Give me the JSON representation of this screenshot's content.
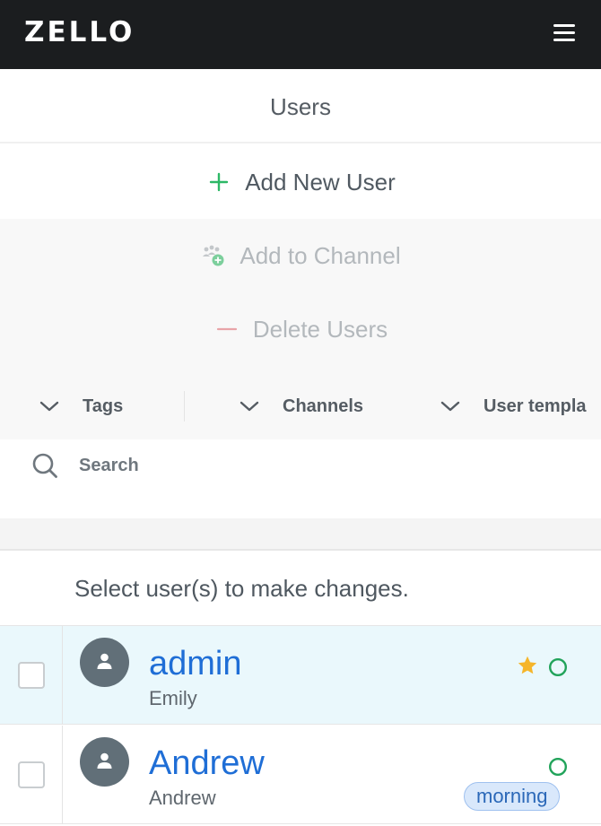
{
  "app": {
    "logo_text": "ZELLO",
    "menu_icon": "hamburger-menu-icon"
  },
  "page": {
    "title": "Users"
  },
  "actions": {
    "add_user_label": "Add New User",
    "add_user_icon": "plus-icon",
    "add_to_channel_label": "Add to Channel",
    "add_to_channel_icon": "group-add-icon",
    "delete_users_label": "Delete Users",
    "delete_users_icon": "minus-icon"
  },
  "filters": [
    {
      "label": "Tags",
      "icon": "chevron-down-icon"
    },
    {
      "label": "Channels",
      "icon": "chevron-down-icon"
    },
    {
      "label": "User templa",
      "icon": "chevron-down-icon"
    }
  ],
  "search": {
    "placeholder": "Search",
    "value": ""
  },
  "hint": "Select user(s) to make changes.",
  "users": [
    {
      "username": "admin",
      "display_name": "Emily",
      "starred": true,
      "tag": "",
      "selected": false,
      "highlighted": true
    },
    {
      "username": "Andrew",
      "display_name": "Andrew",
      "starred": false,
      "tag": "morning",
      "selected": false,
      "highlighted": false
    }
  ],
  "colors": {
    "topbar": "#1b1d1f",
    "link_blue": "#1f6ed6",
    "plus_green": "#2db866",
    "minus_red": "#e8a4a8",
    "star_gold": "#f5b52a",
    "status_green": "#21a35a",
    "row_highlight": "#eaf8fc"
  }
}
